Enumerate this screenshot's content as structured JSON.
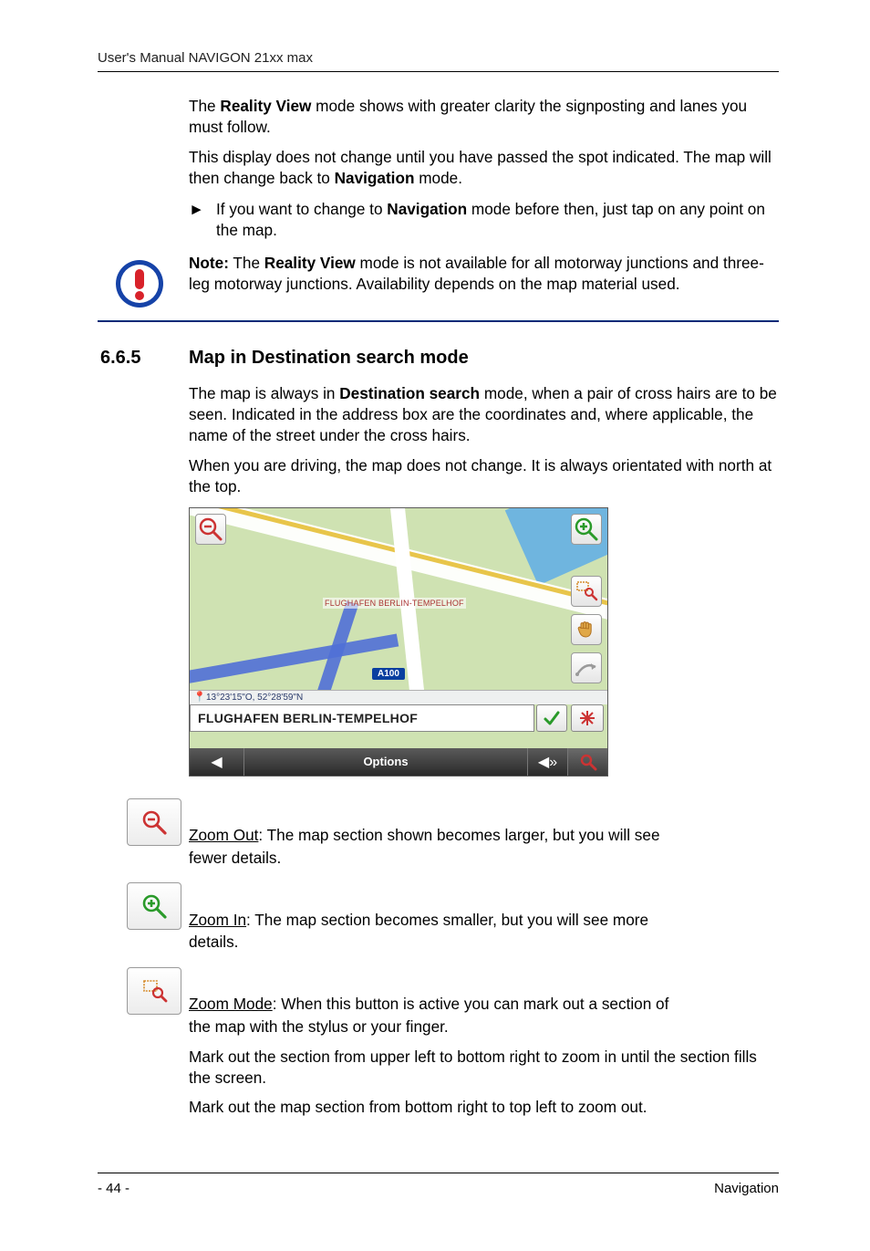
{
  "header": {
    "text": "User's Manual NAVIGON 21xx max"
  },
  "intro": {
    "p1_a": "The ",
    "p1_b": "Reality View",
    "p1_c": " mode shows with greater clarity the signposting and lanes you must follow.",
    "p2_a": "This display does not change until you have passed the spot indicated. The map will then change back to ",
    "p2_b": "Navigation",
    "p2_c": " mode.",
    "bullet_mark": "►",
    "bullet_a": "If you want to change to ",
    "bullet_b": "Navigation",
    "bullet_c": " mode before then, just tap on any point on the map."
  },
  "note": {
    "label": "Note:",
    "a": " The ",
    "b": "Reality View",
    "c": " mode is not available for all motorway junctions and three-leg motorway junctions. Availability depends on the map material used."
  },
  "section": {
    "number": "6.6.5",
    "title": "Map in Destination search mode",
    "p1_a": "The map is always in ",
    "p1_b": "Destination search",
    "p1_c": " mode, when a pair of cross hairs are to be seen. Indicated in the address box are the coordinates and, where applicable, the name of the street under the cross hairs.",
    "p2": "When you are driving, the map does not change. It is always orientated with north at the top."
  },
  "map": {
    "poi_label": "FLUGHAFEN BERLIN-TEMPELHOF",
    "road_shield": "A100",
    "coords": "13°23'15\"O, 52°28'59\"N",
    "address": "FLUGHAFEN BERLIN-TEMPELHOF",
    "options_label": "Options",
    "back_glyph": "◀",
    "speaker_glyph": "◀»",
    "check_glyph": "✓",
    "pin_glyph": "✳"
  },
  "zoom_out": {
    "label": "Zoom Out",
    "rest": ": The map section shown becomes larger, but you will see",
    "cont": "fewer details."
  },
  "zoom_in": {
    "label": "Zoom In",
    "rest": ": The map section becomes smaller, but you will see more",
    "cont": "details."
  },
  "zoom_mode": {
    "label": "Zoom Mode",
    "rest": ": When this button is active you can mark out a section of",
    "cont1": "the map with the stylus or your finger.",
    "cont2": "Mark out the section from upper left to bottom right to zoom in until the section fills the screen.",
    "cont3": "Mark out the map section from bottom right to top left to zoom out."
  },
  "footer": {
    "page": "- 44 -",
    "section": "Navigation"
  }
}
